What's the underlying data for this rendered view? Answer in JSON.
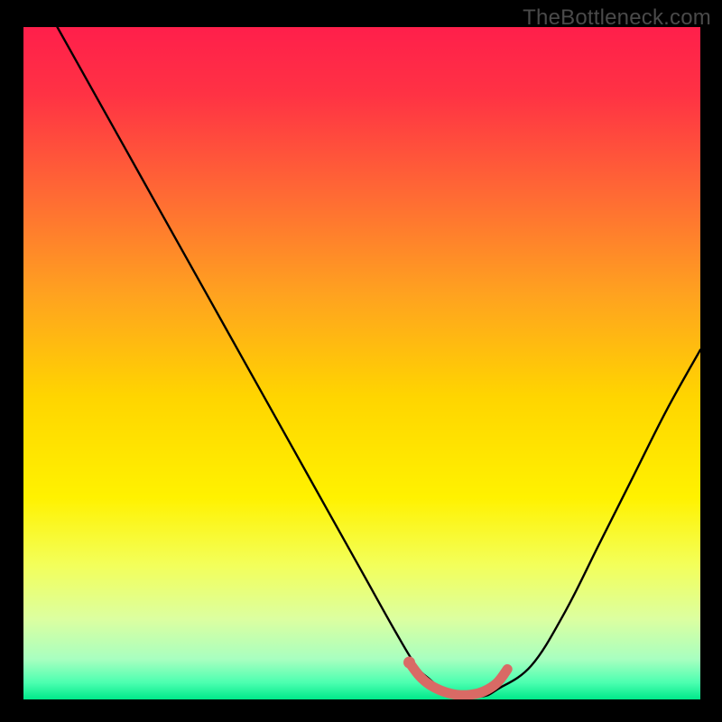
{
  "watermark": "TheBottleneck.com",
  "colors": {
    "frame_bg": "#000000",
    "gradient_stops": [
      {
        "offset": 0.0,
        "color": "#ff1f4b"
      },
      {
        "offset": 0.1,
        "color": "#ff3244"
      },
      {
        "offset": 0.25,
        "color": "#ff6a34"
      },
      {
        "offset": 0.4,
        "color": "#ffa31f"
      },
      {
        "offset": 0.55,
        "color": "#ffd500"
      },
      {
        "offset": 0.7,
        "color": "#fff200"
      },
      {
        "offset": 0.8,
        "color": "#f3ff5a"
      },
      {
        "offset": 0.88,
        "color": "#dcffa0"
      },
      {
        "offset": 0.94,
        "color": "#a8ffc0"
      },
      {
        "offset": 0.975,
        "color": "#4cffb0"
      },
      {
        "offset": 1.0,
        "color": "#00e88a"
      }
    ],
    "curve": "#000000",
    "highlight": "#d96a65"
  },
  "chart_data": {
    "type": "line",
    "title": "",
    "xlabel": "",
    "ylabel": "",
    "xlim": [
      0,
      100
    ],
    "ylim": [
      0,
      100
    ],
    "grid": false,
    "legend_position": "none",
    "annotations": [
      "TheBottleneck.com"
    ],
    "series": [
      {
        "name": "bottleneck-curve",
        "x": [
          5,
          10,
          15,
          20,
          25,
          30,
          35,
          40,
          45,
          50,
          55,
          58,
          60,
          62,
          65,
          68,
          70,
          75,
          80,
          85,
          90,
          95,
          100
        ],
        "y": [
          100,
          91,
          82,
          73,
          64,
          55,
          46,
          37,
          28,
          19,
          10,
          5,
          3,
          1.5,
          0.5,
          0.5,
          1.5,
          5,
          13,
          23,
          33,
          43,
          52
        ]
      },
      {
        "name": "optimal-range-highlight",
        "x": [
          57,
          58.5,
          60,
          62,
          64,
          66,
          68,
          70,
          71.5
        ],
        "y": [
          5.5,
          3.5,
          2.2,
          1.2,
          0.7,
          0.7,
          1.2,
          2.5,
          4.5
        ]
      }
    ]
  }
}
